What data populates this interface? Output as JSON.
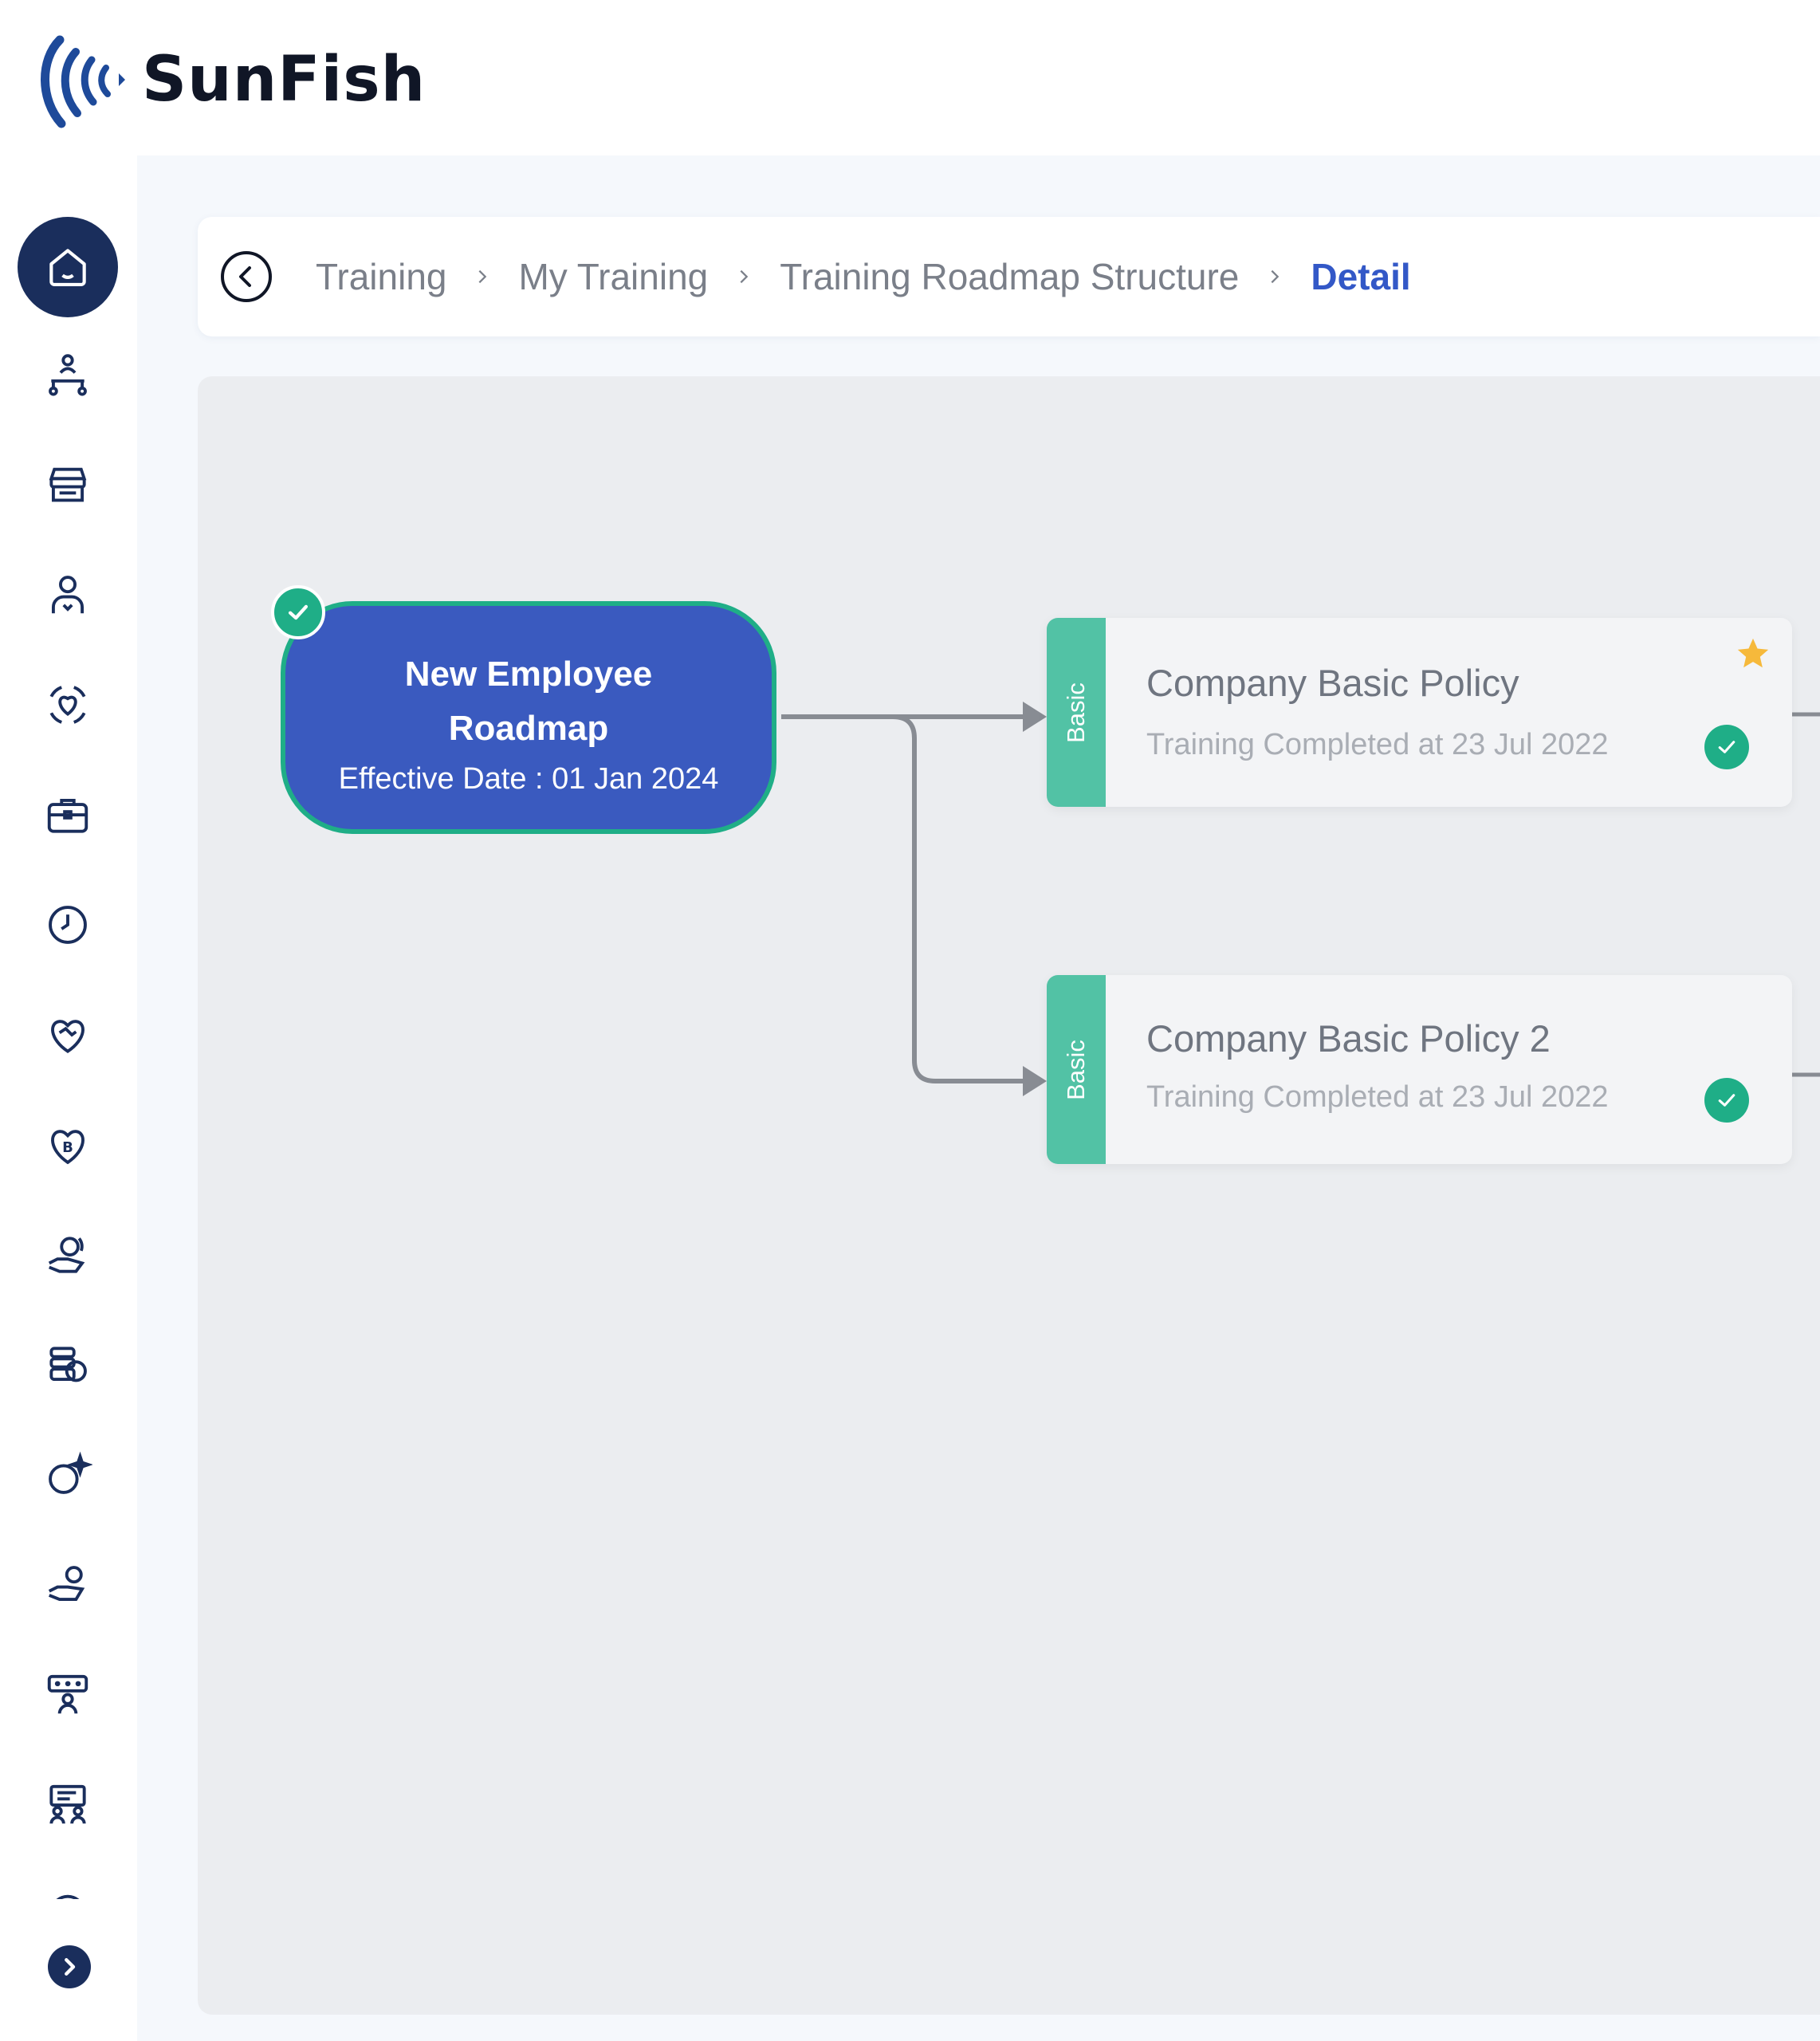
{
  "app": {
    "brand": "SunFish"
  },
  "breadcrumb": {
    "items": [
      "Training",
      "My Training",
      "Training Roadmap Structure"
    ],
    "current": "Detail"
  },
  "sidebar": {
    "icons": [
      "home-icon",
      "org-structure-icon",
      "store-icon",
      "person-icon",
      "care-icon",
      "briefcase-icon",
      "clock-icon",
      "heart-handshake-icon",
      "heart-coin-icon",
      "hand-coin-refresh-icon",
      "coins-heart-icon",
      "coin-sparkle-icon",
      "hand-coin-icon",
      "rating-person-icon",
      "presentation-icon",
      "dashboard-icon"
    ],
    "expand_icon": "chevron-right-icon"
  },
  "roadmap": {
    "root": {
      "title": "New Employee Roadmap",
      "effective": "Effective Date : 01 Jan 2024",
      "completed": true
    },
    "cards": [
      {
        "tag": "Basic",
        "title": "Company Basic Policy",
        "subtitle": "Training Completed at 23 Jul 2022",
        "starred": true,
        "completed": true
      },
      {
        "tag": "Basic",
        "title": "Company Basic Policy 2",
        "subtitle": "Training Completed at 23 Jul 2022",
        "starred": false,
        "completed": true
      }
    ]
  },
  "colors": {
    "navy": "#1a2e5c",
    "root_fill": "#3a5abf",
    "success_green": "#1fae87",
    "tag_teal": "#52c2a5",
    "breadcrumb_active": "#3358c7",
    "star": "#f6b93b"
  }
}
